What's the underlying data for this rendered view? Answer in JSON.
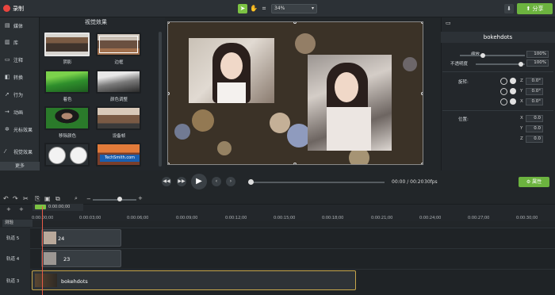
{
  "app": {
    "record_label": "录制",
    "share_label": "分享",
    "zoom_value": "34%"
  },
  "sidebar": {
    "items": [
      {
        "label": "媒体",
        "icon": "media-icon"
      },
      {
        "label": "库",
        "icon": "library-icon"
      },
      {
        "label": "注释",
        "icon": "annotation-icon"
      },
      {
        "label": "转换",
        "icon": "transition-icon"
      },
      {
        "label": "行为",
        "icon": "behavior-icon"
      },
      {
        "label": "动画",
        "icon": "animation-icon"
      },
      {
        "label": "光标效果",
        "icon": "cursor-effect-icon"
      },
      {
        "label": "视觉效果",
        "icon": "visual-effect-icon"
      }
    ],
    "more_label": "更多"
  },
  "effects": {
    "title": "视觉效果",
    "items": [
      {
        "label": "阴影"
      },
      {
        "label": "边框"
      },
      {
        "label": "着色"
      },
      {
        "label": "颜色调整"
      },
      {
        "label": "移除颜色"
      },
      {
        "label": "设备帧"
      },
      {
        "label": ""
      },
      {
        "label": ""
      }
    ],
    "tooltip": "TechSmith.com"
  },
  "player": {
    "timecode": "00:00 / 00:20",
    "fps": "30fps",
    "properties_label": "属性"
  },
  "properties": {
    "title": "bokehdots",
    "scale_label": "缩放",
    "scale_value": "100%",
    "opacity_label": "不透明度",
    "opacity_value": "100%",
    "rotation_label": "旋转:",
    "rotation": [
      {
        "axis": "Z",
        "value": "0.0°"
      },
      {
        "axis": "Y",
        "value": "0.0°"
      },
      {
        "axis": "X",
        "value": "0.0°"
      }
    ],
    "position_label": "位置:",
    "position": [
      {
        "axis": "X",
        "value": "0.0"
      },
      {
        "axis": "Y",
        "value": "0.0"
      },
      {
        "axis": "Z",
        "value": "0.0"
      }
    ]
  },
  "timeline": {
    "playhead_time": "0:00:00;00",
    "marker_label": "测验",
    "ticks": [
      "0:00:00;00",
      "0:00:03;00",
      "0:00:06;00",
      "0:00:09;00",
      "0:00:12;00",
      "0:00:15;00",
      "0:00:18;00",
      "0:00:21;00",
      "0:00:24;00",
      "0:00:27;00",
      "0:00:30;00"
    ],
    "tracks": [
      {
        "label": "轨道 5",
        "clip": "24"
      },
      {
        "label": "轨道 4",
        "clip": "23"
      },
      {
        "label": "轨道 3",
        "clip": "bokehdots"
      }
    ]
  }
}
